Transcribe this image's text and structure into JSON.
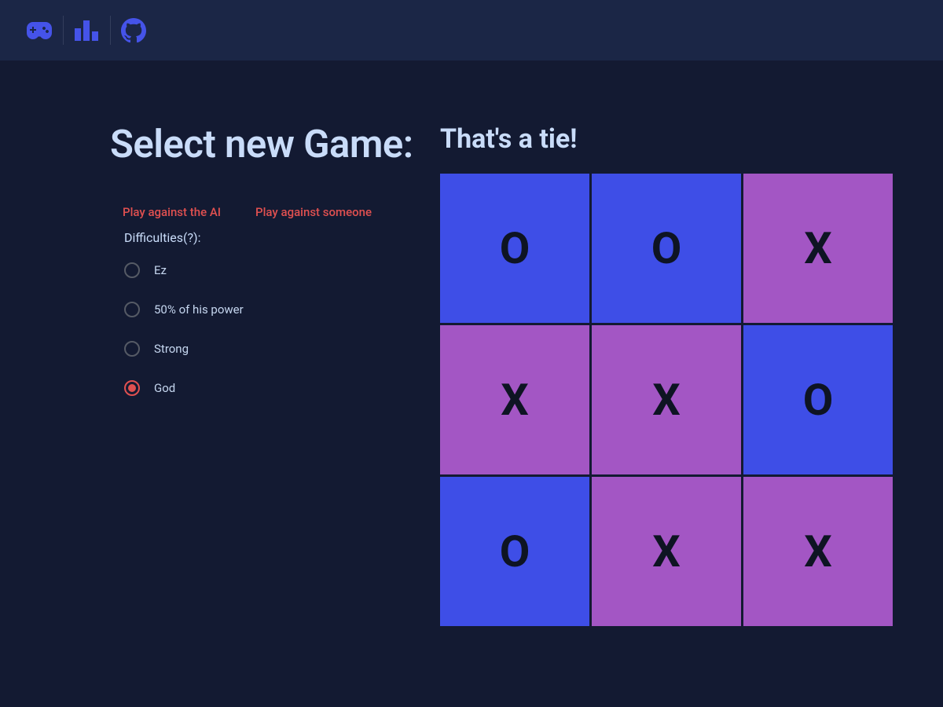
{
  "nav": {
    "items": [
      {
        "name": "gamepad-icon"
      },
      {
        "name": "leaderboard-icon"
      },
      {
        "name": "github-icon"
      }
    ]
  },
  "left": {
    "title": "Select new Game:",
    "modes": {
      "ai": "Play against the AI",
      "human": "Play against someone"
    },
    "difficulties_label": "Difficulties(?):",
    "difficulties": [
      {
        "id": "ez",
        "label": "Ez",
        "selected": false
      },
      {
        "id": "half",
        "label": "50% of his power",
        "selected": false
      },
      {
        "id": "strong",
        "label": "Strong",
        "selected": false
      },
      {
        "id": "god",
        "label": "God",
        "selected": true
      }
    ]
  },
  "game": {
    "status_text": "That's a tie!",
    "cells": [
      [
        "O",
        "O",
        "X"
      ],
      [
        "X",
        "X",
        "O"
      ],
      [
        "O",
        "X",
        "X"
      ]
    ]
  },
  "colors": {
    "bg": "#131a32",
    "topbar": "#1b2646",
    "accent": "#4553e8",
    "text": "#c9dcf9",
    "danger": "#e05050",
    "cellO": "#3e4ee7",
    "cellX": "#a356c4"
  }
}
